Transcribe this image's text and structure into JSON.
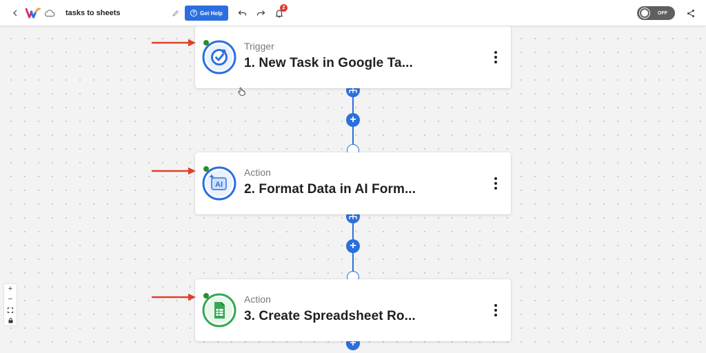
{
  "topbar": {
    "title": "tasks to sheets",
    "help_label": "Get Help",
    "notification_count": "2",
    "toggle_label": "OFF"
  },
  "steps": [
    {
      "type": "Trigger",
      "title": "1. New Task in Google Ta...",
      "app": "google-tasks",
      "status_color": "#2e8b2e"
    },
    {
      "type": "Action",
      "title": "2. Format Data in AI Form...",
      "app": "ai-formatter",
      "status_color": "#2e8b2e"
    },
    {
      "type": "Action",
      "title": "3. Create Spreadsheet Ro...",
      "app": "google-sheets",
      "status_color": "#2e8b2e"
    }
  ],
  "icons": {
    "ai_label": "AI"
  },
  "zoom_controls": {
    "zoom_in": "+",
    "zoom_out": "−"
  },
  "colors": {
    "accent": "#2b6fde",
    "annotation": "#e0402a",
    "status": "#2e8b2e",
    "sheets": "#34a853"
  }
}
